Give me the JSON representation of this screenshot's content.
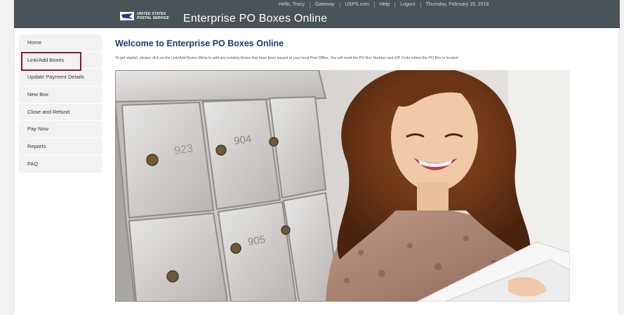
{
  "header": {
    "utility_links": [
      "Hello, Tracy",
      "Gateway",
      "USPS.com",
      "Help",
      "Logout",
      "Thursday, February 15, 2018"
    ],
    "logo_line1": "UNITED STATES",
    "logo_line2": "POSTAL SERVICE",
    "app_title": "Enterprise PO Boxes Online"
  },
  "sidebar": {
    "items": [
      {
        "label": "Home"
      },
      {
        "label": "Link/Add Boxes",
        "selected": true
      },
      {
        "label": "Update Payment Details"
      },
      {
        "label": "New Box"
      },
      {
        "label": "Close and Refund"
      },
      {
        "label": "Pay Now"
      },
      {
        "label": "Reports"
      },
      {
        "label": "FAQ"
      }
    ],
    "highlight_color": "#8b1a2b"
  },
  "main": {
    "title": "Welcome to Enterprise PO Boxes Online",
    "intro": "To get started, please click on the Link/Add Boxes Menu to add any existing boxes that have been issued at your local Post Office. You will need the PO Box Number and ZIP Code where the PO Box is located.",
    "hero_box_numbers": [
      "923",
      "904",
      "905"
    ]
  },
  "colors": {
    "header_bg": "#4a5358",
    "title_blue": "#1c3a7a"
  }
}
